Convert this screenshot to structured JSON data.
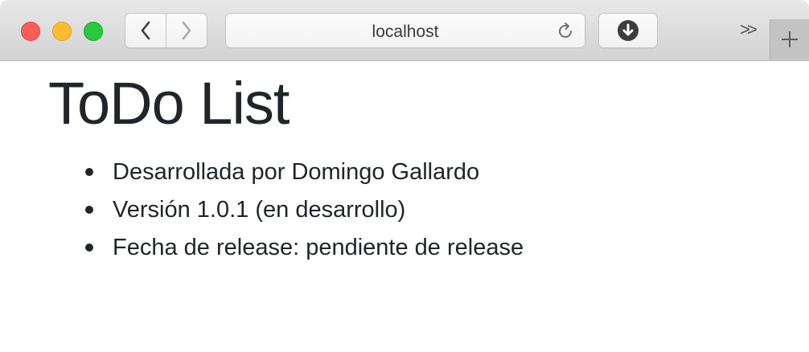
{
  "browser": {
    "url": "localhost",
    "icons": {
      "close": "close-window",
      "minimize": "minimize-window",
      "maximize": "maximize-window",
      "back": "chevron-left-icon",
      "forward": "chevron-right-icon",
      "reload": "reload-icon",
      "download": "download-icon",
      "overflow": ">>",
      "new_tab": "plus-icon"
    },
    "colors": {
      "close": "#fd5f57",
      "minimize": "#febc2e",
      "maximize": "#28c840"
    }
  },
  "page": {
    "title": "ToDo List",
    "items": [
      "Desarrollada por Domingo Gallardo",
      "Versión 1.0.1 (en desarrollo)",
      "Fecha de release: pendiente de release"
    ]
  }
}
